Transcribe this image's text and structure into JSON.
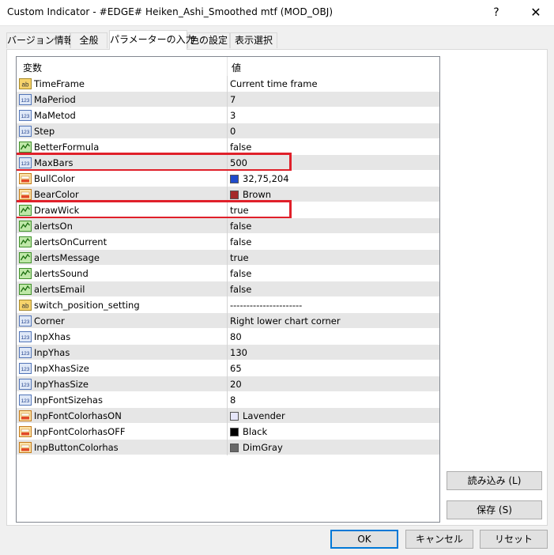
{
  "window": {
    "title": "Custom Indicator - #EDGE# Heiken_Ashi_Smoothed mtf (MOD_OBJ)",
    "help_label": "?",
    "close_label": "✕"
  },
  "tabs": [
    {
      "label": "バージョン情報",
      "active": false
    },
    {
      "label": "全般",
      "active": false
    },
    {
      "label": "パラメーターの入力",
      "active": true
    },
    {
      "label": "色の設定",
      "active": false
    },
    {
      "label": "表示選択",
      "active": false
    }
  ],
  "grid": {
    "header": {
      "variable": "変数",
      "value": "値"
    },
    "rows": [
      {
        "name": "TimeFrame",
        "value": "Current time frame",
        "type": "ab"
      },
      {
        "name": "MaPeriod",
        "value": "7",
        "type": "int"
      },
      {
        "name": "MaMetod",
        "value": "3",
        "type": "int"
      },
      {
        "name": "Step",
        "value": "0",
        "type": "int"
      },
      {
        "name": "BetterFormula",
        "value": "false",
        "type": "bool"
      },
      {
        "name": "MaxBars",
        "value": "500",
        "type": "int",
        "highlighted": true
      },
      {
        "name": "BullColor",
        "value": "32,75,204",
        "type": "color",
        "swatch": "#204bcc"
      },
      {
        "name": "BearColor",
        "value": "Brown",
        "type": "color",
        "swatch": "#a52a2a"
      },
      {
        "name": "DrawWick",
        "value": "true",
        "type": "bool",
        "highlighted": true
      },
      {
        "name": "alertsOn",
        "value": "false",
        "type": "bool"
      },
      {
        "name": "alertsOnCurrent",
        "value": "false",
        "type": "bool"
      },
      {
        "name": "alertsMessage",
        "value": "true",
        "type": "bool"
      },
      {
        "name": "alertsSound",
        "value": "false",
        "type": "bool"
      },
      {
        "name": "alertsEmail",
        "value": "false",
        "type": "bool"
      },
      {
        "name": "switch_position_setting",
        "value": "----------------------",
        "type": "ab"
      },
      {
        "name": "Corner",
        "value": "Right lower chart corner",
        "type": "int"
      },
      {
        "name": "InpXhas",
        "value": "80",
        "type": "int"
      },
      {
        "name": "InpYhas",
        "value": "130",
        "type": "int"
      },
      {
        "name": "InpXhasSize",
        "value": "65",
        "type": "int"
      },
      {
        "name": "InpYhasSize",
        "value": "20",
        "type": "int"
      },
      {
        "name": "InpFontSizehas",
        "value": "8",
        "type": "int"
      },
      {
        "name": "InpFontColorhasON",
        "value": "Lavender",
        "type": "color",
        "swatch": "#e6e6fa"
      },
      {
        "name": "InpFontColorhasOFF",
        "value": "Black",
        "type": "color",
        "swatch": "#000000"
      },
      {
        "name": "InpButtonColorhas",
        "value": "DimGray",
        "type": "color",
        "swatch": "#696969"
      }
    ]
  },
  "side_buttons": {
    "load": "読み込み (L)",
    "save": "保存 (S)"
  },
  "footer": {
    "ok": "OK",
    "cancel": "キャンセル",
    "reset": "リセット"
  },
  "colors": {
    "highlight": "#e0202a",
    "accent": "#0078d7"
  }
}
